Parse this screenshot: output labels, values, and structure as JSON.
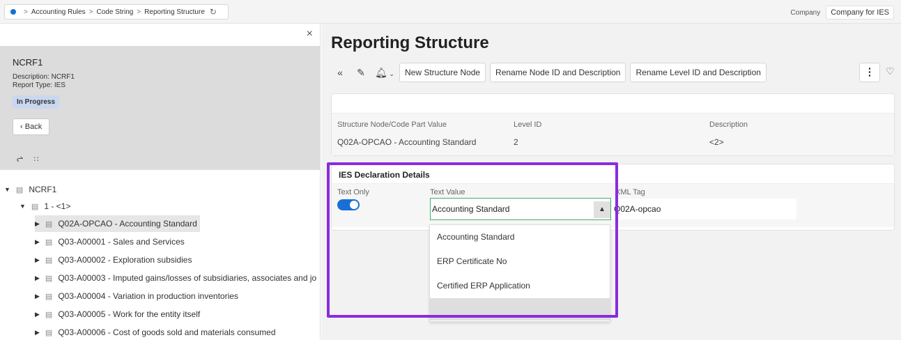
{
  "breadcrumb": [
    "Accounting Rules",
    "Code String",
    "Reporting Structure"
  ],
  "company": {
    "label": "Company",
    "value": "Company for IES"
  },
  "left": {
    "record_title": "NCRF1",
    "description": "Description:  NCRF1",
    "report_type": "Report Type:  IES",
    "status": "In Progress",
    "back_label": "Back"
  },
  "tree": [
    {
      "label": "NCRF1",
      "level": 0,
      "expanded": true
    },
    {
      "label": "1 - <1>",
      "level": 1,
      "expanded": true
    },
    {
      "label": "Q02A-OPCAO - Accounting Standard",
      "level": 2,
      "selected": true
    },
    {
      "label": "Q03-A00001 - Sales and Services",
      "level": 2
    },
    {
      "label": "Q03-A00002 - Exploration subsidies",
      "level": 2
    },
    {
      "label": "Q03-A00003 - Imputed gains/losses of subsidiaries, associates and jo",
      "level": 2
    },
    {
      "label": "Q03-A00004 - Variation in production inventories",
      "level": 2
    },
    {
      "label": "Q03-A00005 - Work for the entity itself",
      "level": 2
    },
    {
      "label": "Q03-A00006 - Cost of goods sold and materials consumed",
      "level": 2
    }
  ],
  "main": {
    "title": "Reporting Structure",
    "buttons": [
      "New Structure Node",
      "Rename Node ID and Description",
      "Rename Level ID and Description"
    ]
  },
  "node_card": {
    "fields": [
      {
        "label": "Structure Node/Code Part Value",
        "value": "Q02A-OPCAO - Accounting Standard"
      },
      {
        "label": "Level ID",
        "value": "2"
      },
      {
        "label": "Description",
        "value": "<2>"
      }
    ]
  },
  "ies_card": {
    "title": "IES Declaration Details",
    "text_only_label": "Text Only",
    "text_only": true,
    "text_value_label": "Text Value",
    "text_value": "Accounting Standard",
    "xml_tag_label": "XML Tag",
    "xml_tag_value": "Q02A-opcao"
  },
  "dropdown_options": [
    "Accounting Standard",
    "ERP Certificate No",
    "Certified ERP Application",
    ""
  ],
  "colors": {
    "accent": "#1a6fd6",
    "highlight": "#8a2be2",
    "status_badge": "#c9d8f0"
  }
}
